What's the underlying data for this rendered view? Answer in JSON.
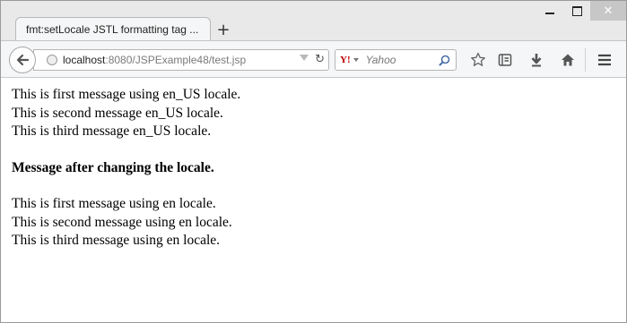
{
  "window": {
    "tab_title": "fmt:setLocale JSTL formatting tag ...",
    "new_tab_symbol": "+",
    "controls": {
      "minimize": "minimize",
      "maximize": "maximize",
      "close": "✕"
    }
  },
  "toolbar": {
    "url_host": "localhost",
    "url_rest": ":8080/JSPExample48/test.jsp",
    "search_engine": "Y!",
    "search_placeholder": "Yahoo",
    "icons": [
      "back-arrow-icon",
      "globe-icon",
      "dropdown-icon",
      "reload-icon",
      "search-glass-icon",
      "bookmark-star-icon",
      "reading-list-icon",
      "download-icon",
      "home-icon",
      "menu-icon"
    ]
  },
  "page": {
    "lines_before": [
      "This is first message using en_US locale.",
      "This is second message en_US locale.",
      "This is third message en_US locale."
    ],
    "heading": "Message after changing the locale.",
    "lines_after": [
      "This is first message using en locale.",
      "This is second message using en locale.",
      "This is third message using en locale."
    ]
  }
}
